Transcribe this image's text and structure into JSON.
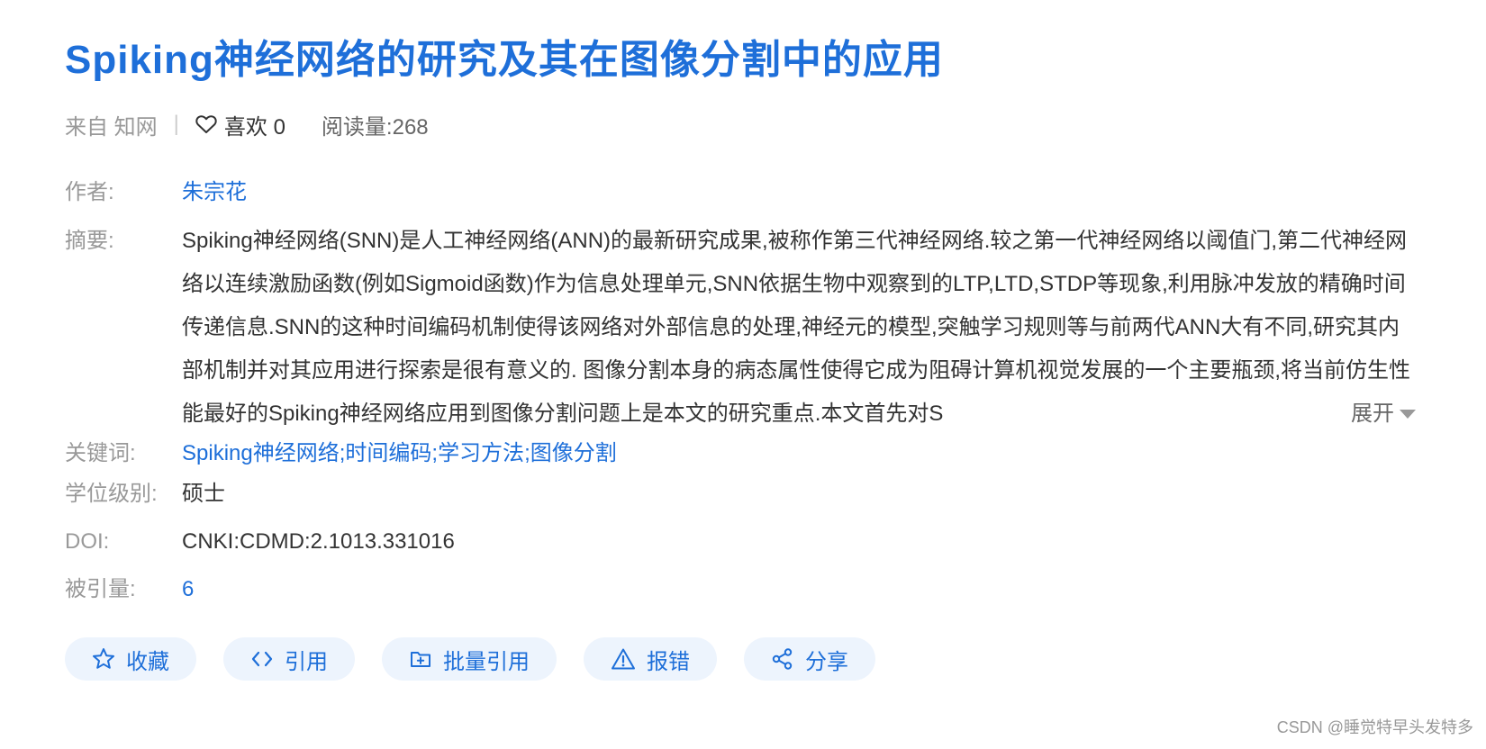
{
  "title": "Spiking神经网络的研究及其在图像分割中的应用",
  "meta": {
    "source": "来自 知网",
    "separator": "|",
    "like_label": "喜欢 0",
    "read_label": "阅读量:",
    "read_count": "268"
  },
  "details": {
    "author_label": "作者:",
    "author": "朱宗花",
    "abstract_label": "摘要:",
    "abstract": "Spiking神经网络(SNN)是人工神经网络(ANN)的最新研究成果,被称作第三代神经网络.较之第一代神经网络以阈值门,第二代神经网络以连续激励函数(例如Sigmoid函数)作为信息处理单元,SNN依据生物中观察到的LTP,LTD,STDP等现象,利用脉冲发放的精确时间传递信息.SNN的这种时间编码机制使得该网络对外部信息的处理,神经元的模型,突触学习规则等与前两代ANN大有不同,研究其内部机制并对其应用进行探索是很有意义的. 图像分割本身的病态属性使得它成为阻碍计算机视觉发展的一个主要瓶颈,将当前仿生性能最好的Spiking神经网络应用到图像分割问题上是本文的研究重点.本文首先对S",
    "expand_label": "展开",
    "keywords_label": "关键词:",
    "keywords": [
      "Spiking神经网络",
      "时间编码",
      "学习方法",
      "图像分割"
    ],
    "keyword_separator": ";",
    "degree_label": "学位级别:",
    "degree": "硕士",
    "doi_label": "DOI:",
    "doi": "CNKI:CDMD:2.1013.331016",
    "cited_label": "被引量:",
    "cited": "6"
  },
  "actions": {
    "collect": "收藏",
    "cite": "引用",
    "batch_cite": "批量引用",
    "report": "报错",
    "share": "分享"
  },
  "watermark": "CSDN @睡觉特早头发特多",
  "colors": {
    "accent": "#1e6fd9",
    "button_bg": "#edf4fd",
    "label": "#999999",
    "text": "#333333"
  }
}
